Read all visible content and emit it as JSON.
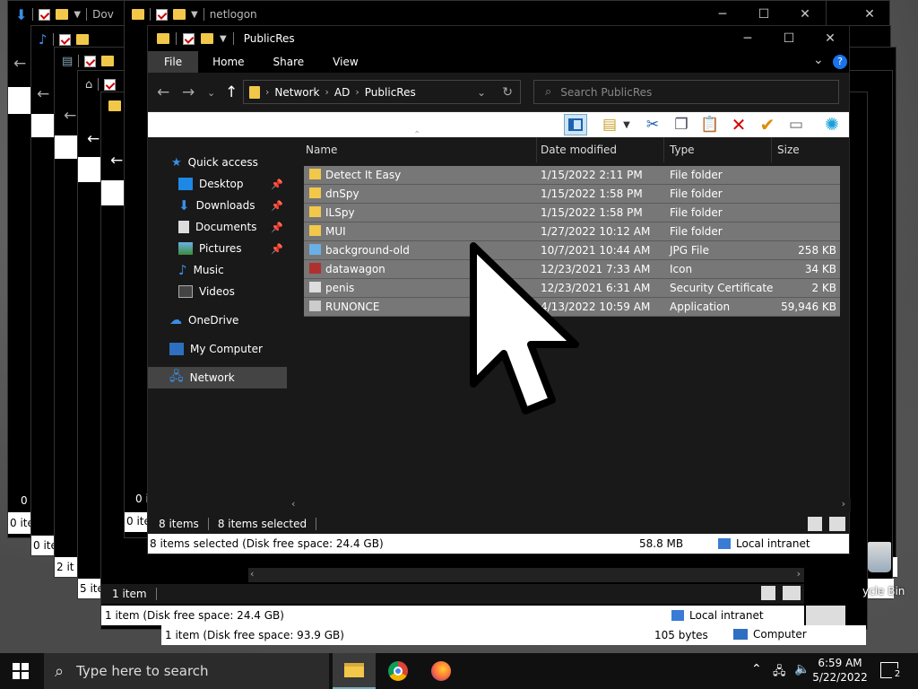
{
  "background_windows": {
    "w1_title": "Dov",
    "w2_title": "netlogon",
    "menu_letter": "F",
    "status_items": [
      "0 i",
      "0 ite",
      "0 ite",
      "2 it",
      "5 ite",
      "0 i",
      "0 ite"
    ],
    "w_item_status": "1 item",
    "w_item_status2": "1 item (Disk free space: 24.4 GB)",
    "w_local": "Local intranet",
    "w_back_status": "1 item (Disk free space: 93.9 GB)",
    "w_back_size": "105 bytes",
    "w_back_zone": "Computer",
    "recycle_label": "ycle Bin"
  },
  "main": {
    "title": "PublicRes",
    "tabs": [
      "File",
      "Home",
      "Share",
      "View"
    ],
    "breadcrumb": [
      "Network",
      "AD",
      "PublicRes"
    ],
    "search_placeholder": "Search PublicRes",
    "nav": [
      {
        "label": "Quick access",
        "icon": "star-icon"
      },
      {
        "label": "Desktop",
        "icon": "desktop-icon",
        "pinned": true
      },
      {
        "label": "Downloads",
        "icon": "download-icon",
        "pinned": true
      },
      {
        "label": "Documents",
        "icon": "document-icon",
        "pinned": true
      },
      {
        "label": "Pictures",
        "icon": "picture-icon",
        "pinned": true
      },
      {
        "label": "Music",
        "icon": "music-icon"
      },
      {
        "label": "Videos",
        "icon": "video-icon"
      },
      {
        "label": "OneDrive",
        "icon": "cloud-icon"
      },
      {
        "label": "My Computer",
        "icon": "computer-icon"
      },
      {
        "label": "Network",
        "icon": "network-icon"
      }
    ],
    "columns": [
      "Name",
      "Date modified",
      "Type",
      "Size"
    ],
    "files": [
      {
        "name": "Detect It Easy",
        "date": "1/15/2022 2:11 PM",
        "type": "File folder",
        "size": ""
      },
      {
        "name": "dnSpy",
        "date": "1/15/2022 1:58 PM",
        "type": "File folder",
        "size": ""
      },
      {
        "name": "ILSpy",
        "date": "1/15/2022 1:58 PM",
        "type": "File folder",
        "size": ""
      },
      {
        "name": "MUI",
        "date": "1/27/2022 10:12 AM",
        "type": "File folder",
        "size": ""
      },
      {
        "name": "background-old",
        "date": "10/7/2021 10:44 AM",
        "type": "JPG File",
        "size": "258 KB"
      },
      {
        "name": "datawagon",
        "date": "12/23/2021 7:33 AM",
        "type": "Icon",
        "size": "34 KB"
      },
      {
        "name": "penis",
        "date": "12/23/2021 6:31 AM",
        "type": "Security Certificate",
        "size": "2 KB"
      },
      {
        "name": "RUNONCE",
        "date": "4/13/2022 10:59 AM",
        "type": "Application",
        "size": "59,946 KB"
      }
    ],
    "item_count": "8 items",
    "selected_count": "8 items selected",
    "status_text": "8 items selected (Disk free space: 24.4 GB)",
    "status_size": "58.8 MB",
    "status_zone": "Local intranet"
  },
  "taskbar": {
    "search_placeholder": "Type here to search",
    "time": "6:59 AM",
    "date": "5/22/2022",
    "notif_count": "2"
  }
}
